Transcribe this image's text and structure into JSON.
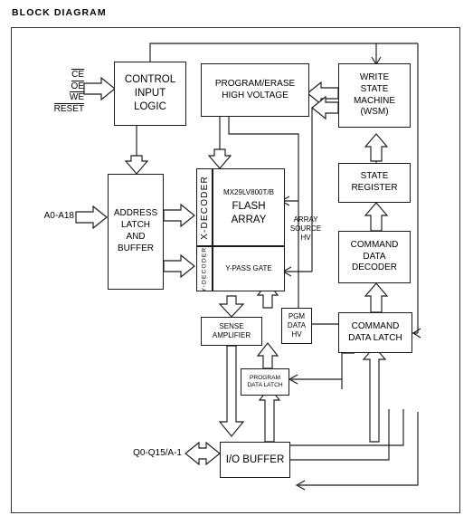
{
  "diagram": {
    "title": "BLOCK DIAGRAM",
    "part_number": "MX29LV800T/B",
    "blocks": [
      {
        "id": "control-input-logic",
        "lines": [
          "CONTROL",
          "INPUT",
          "LOGIC"
        ]
      },
      {
        "id": "program-erase-high-voltage",
        "lines": [
          "PROGRAM/ERASE",
          "HIGH VOLTAGE"
        ]
      },
      {
        "id": "write-state-machine",
        "lines": [
          "WRITE",
          "STATE",
          "MACHINE",
          "(WSM)"
        ]
      },
      {
        "id": "address-latch-and-buffer",
        "lines": [
          "ADDRESS",
          "LATCH",
          "AND",
          "BUFFER"
        ]
      },
      {
        "id": "state-register",
        "lines": [
          "STATE",
          "REGISTER"
        ]
      },
      {
        "id": "command-data-decoder",
        "lines": [
          "COMMAND",
          "DATA",
          "DECODER"
        ]
      },
      {
        "id": "command-data-latch",
        "lines": [
          "COMMAND",
          "DATA LATCH"
        ]
      },
      {
        "id": "x-decoder",
        "lines": [
          "X-DECODER"
        ]
      },
      {
        "id": "y-decoder",
        "lines": [
          "Y-DECODER"
        ]
      },
      {
        "id": "flash-array",
        "lines": [
          "MX29LV800T/B",
          "FLASH",
          "ARRAY"
        ]
      },
      {
        "id": "y-pass-gate",
        "lines": [
          "Y-PASS GATE"
        ]
      },
      {
        "id": "sense-amplifier",
        "lines": [
          "SENSE",
          "AMPLIFIER"
        ]
      },
      {
        "id": "pgm-data-hv",
        "lines": [
          "PGM",
          "DATA",
          "HV"
        ]
      },
      {
        "id": "program-data-latch",
        "lines": [
          "PROGRAM",
          "DATA LATCH"
        ]
      },
      {
        "id": "io-buffer",
        "lines": [
          "I/O BUFFER"
        ]
      }
    ],
    "floating_labels": [
      {
        "id": "array-source-hv",
        "lines": [
          "ARRAY",
          "SOURCE",
          "HV"
        ]
      }
    ],
    "pins": {
      "control_signals": [
        {
          "name": "CE",
          "active_low": true
        },
        {
          "name": "OE",
          "active_low": true
        },
        {
          "name": "WE",
          "active_low": true
        },
        {
          "name": "RESET",
          "active_low": true
        }
      ],
      "address_bus": "A0-A18",
      "data_bus": "Q0-Q15/A-1"
    },
    "colors": {
      "background": "#ffffff",
      "line": "#1a1a1a",
      "frame": "#333333",
      "text": "#000000"
    }
  },
  "text": {
    "ctrl_l0": "CONTROL",
    "ctrl_l1": "INPUT",
    "ctrl_l2": "LOGIC",
    "pehv_l0": "PROGRAM/ERASE",
    "pehv_l1": "HIGH VOLTAGE",
    "wsm_l0": "WRITE",
    "wsm_l1": "STATE",
    "wsm_l2": "MACHINE",
    "wsm_l3": "(WSM)",
    "alb_l0": "ADDRESS",
    "alb_l1": "LATCH",
    "alb_l2": "AND",
    "alb_l3": "BUFFER",
    "sr_l0": "STATE",
    "sr_l1": "REGISTER",
    "cdd_l0": "COMMAND",
    "cdd_l1": "DATA",
    "cdd_l2": "DECODER",
    "cdl_l0": "COMMAND",
    "cdl_l1": "DATA LATCH",
    "xdec": "X-DECODER",
    "ydec": "Y-DECODER",
    "fa_l0": "MX29LV800T/B",
    "fa_l1": "FLASH",
    "fa_l2": "ARRAY",
    "ypg": "Y-PASS GATE",
    "sa_l0": "SENSE",
    "sa_l1": "AMPLIFIER",
    "pgm_l0": "PGM",
    "pgm_l1": "DATA",
    "pgm_l2": "HV",
    "pdl_l0": "PROGRAM",
    "pdl_l1": "DATA LATCH",
    "iob_l0": "I/O BUFFER",
    "ashv_l0": "ARRAY",
    "ashv_l1": "SOURCE",
    "ashv_l2": "HV",
    "pin_ce": "CE",
    "pin_oe": "OE",
    "pin_we": "WE",
    "pin_reset": "RESET",
    "pin_addr": "A0-A18",
    "pin_data": "Q0-Q15/A-1"
  }
}
